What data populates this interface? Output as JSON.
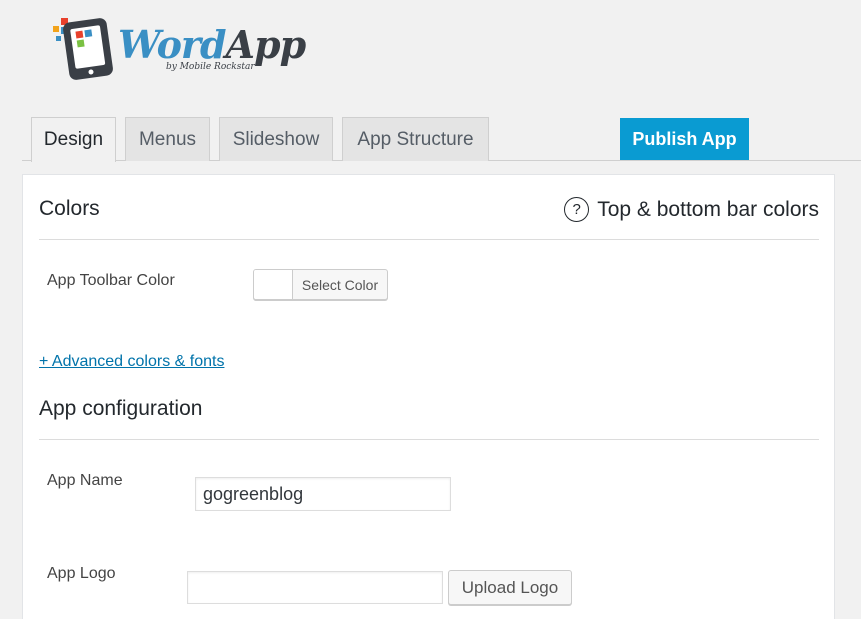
{
  "brand": {
    "name_part1": "Word",
    "name_part2": "App",
    "tagline": "by Mobile Rockstar"
  },
  "tabs": [
    {
      "label": "Design",
      "active": true
    },
    {
      "label": "Menus",
      "active": false
    },
    {
      "label": "Slideshow",
      "active": false
    },
    {
      "label": "App Structure",
      "active": false
    }
  ],
  "publish_label": "Publish App",
  "colors_section": {
    "title": "Colors",
    "help_icon_glyph": "?",
    "help_text": "Top & bottom bar colors",
    "toolbar_color_label": "App Toolbar Color",
    "select_color_label": "Select Color",
    "toolbar_color_value": "#ffffff",
    "advanced_link": "+ Advanced colors & fonts"
  },
  "config_section": {
    "title": "App configuration",
    "app_name_label": "App Name",
    "app_name_value": "gogreenblog",
    "app_logo_label": "App Logo",
    "app_logo_value": "",
    "upload_label": "Upload Logo"
  },
  "theme": {
    "accent": "#0a9bd2",
    "link": "#0073aa",
    "logo_blue": "#3a8fc4",
    "logo_dark": "#3a3f46"
  },
  "icons": {
    "logo": "phone-pixels-icon",
    "help": "question-circle-icon"
  }
}
